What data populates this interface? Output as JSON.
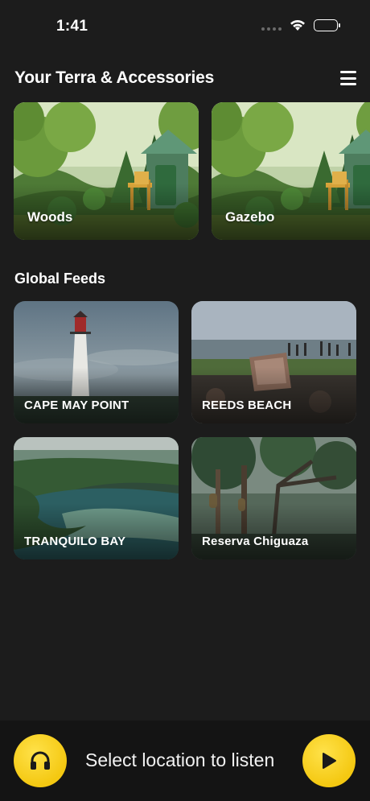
{
  "status": {
    "time": "1:41"
  },
  "terra": {
    "title": "Your Terra & Accessories",
    "items": [
      {
        "label": "Woods"
      },
      {
        "label": "Gazebo"
      }
    ]
  },
  "global_feeds": {
    "title": "Global Feeds",
    "items": [
      {
        "label": "CAPE MAY POINT"
      },
      {
        "label": "REEDS BEACH"
      },
      {
        "label": "TRANQUILO BAY"
      },
      {
        "label": "Reserva Chiguaza"
      }
    ]
  },
  "player": {
    "prompt": "Select location to listen",
    "accent_color": "#f4c811"
  },
  "icons": [
    "wifi-icon",
    "battery-icon",
    "menu-icon",
    "headphones-icon",
    "play-icon"
  ]
}
